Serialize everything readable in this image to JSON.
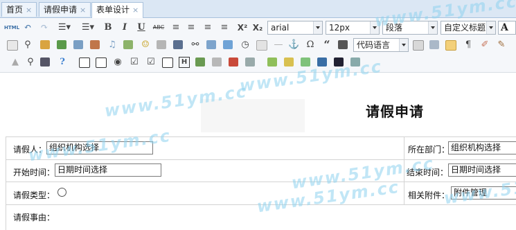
{
  "tabs": [
    {
      "label": "首页",
      "close": "×"
    },
    {
      "label": "请假申请",
      "close": "×"
    },
    {
      "label": "表单设计",
      "close": "×"
    }
  ],
  "toolbar": {
    "font_family": "arial",
    "font_size": "12px",
    "paragraph": "段落",
    "custom_title": "自定义标题",
    "code_language": "代码语言",
    "html_label": "HTML",
    "bold": "B",
    "italic": "I",
    "underline": "U",
    "strike": "ABC",
    "superscript": "X²",
    "subscript": "X₂",
    "font_letter": "A",
    "omega": "Ω",
    "quote": "“"
  },
  "form": {
    "title": "请假申请",
    "applicant_label": "请假人：",
    "applicant_value": "组织机构选择",
    "department_label": "所在部门：",
    "department_value": "组织机构选择",
    "start_label": "开始时间：",
    "start_value": "日期时间选择",
    "end_label": "结束时间：",
    "end_value": "日期时间选择",
    "type_label": "请假类型：",
    "attachment_label": "相关附件：",
    "attachment_value": "附件管理",
    "reason_label": "请假事由："
  },
  "watermark": "www.51ym.cc"
}
